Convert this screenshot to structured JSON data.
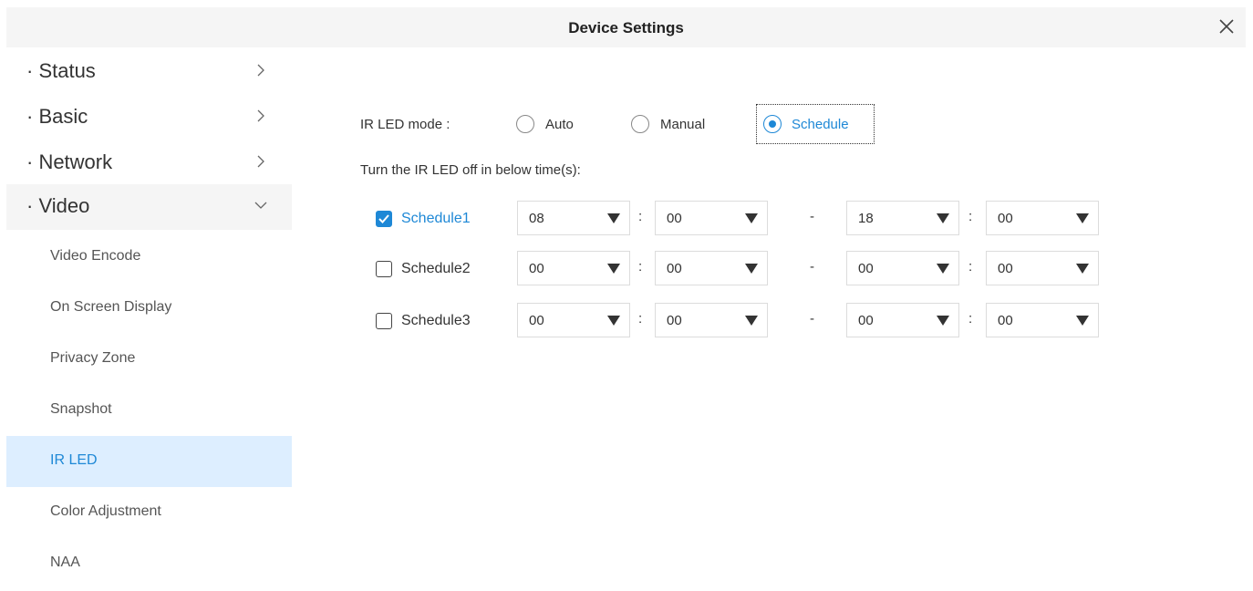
{
  "window": {
    "title": "Device Settings"
  },
  "sidebar": {
    "sections": [
      {
        "label": "· Status",
        "expanded": false
      },
      {
        "label": "· Basic",
        "expanded": false
      },
      {
        "label": "· Network",
        "expanded": false
      },
      {
        "label": "· Video",
        "expanded": true
      }
    ],
    "video_items": [
      {
        "label": "Video Encode",
        "active": false
      },
      {
        "label": "On Screen Display",
        "active": false
      },
      {
        "label": "Privacy Zone",
        "active": false
      },
      {
        "label": "Snapshot",
        "active": false
      },
      {
        "label": "IR LED",
        "active": true
      },
      {
        "label": "Color Adjustment",
        "active": false
      },
      {
        "label": "NAA",
        "active": false
      }
    ]
  },
  "ir_led": {
    "mode_label": "IR LED mode :",
    "modes": [
      {
        "label": "Auto",
        "selected": false
      },
      {
        "label": "Manual",
        "selected": false
      },
      {
        "label": "Schedule",
        "selected": true
      }
    ],
    "description": "Turn the IR LED off in below time(s):",
    "separator_colon": ":",
    "separator_dash": "-",
    "schedules": [
      {
        "label": "Schedule1",
        "checked": true,
        "start_hour": "08",
        "start_min": "00",
        "end_hour": "18",
        "end_min": "00"
      },
      {
        "label": "Schedule2",
        "checked": false,
        "start_hour": "00",
        "start_min": "00",
        "end_hour": "00",
        "end_min": "00"
      },
      {
        "label": "Schedule3",
        "checked": false,
        "start_hour": "00",
        "start_min": "00",
        "end_hour": "00",
        "end_min": "00"
      }
    ]
  },
  "colors": {
    "accent": "#1e88d6",
    "active_bg": "#ddeeff",
    "header_bg": "#f5f5f5"
  }
}
